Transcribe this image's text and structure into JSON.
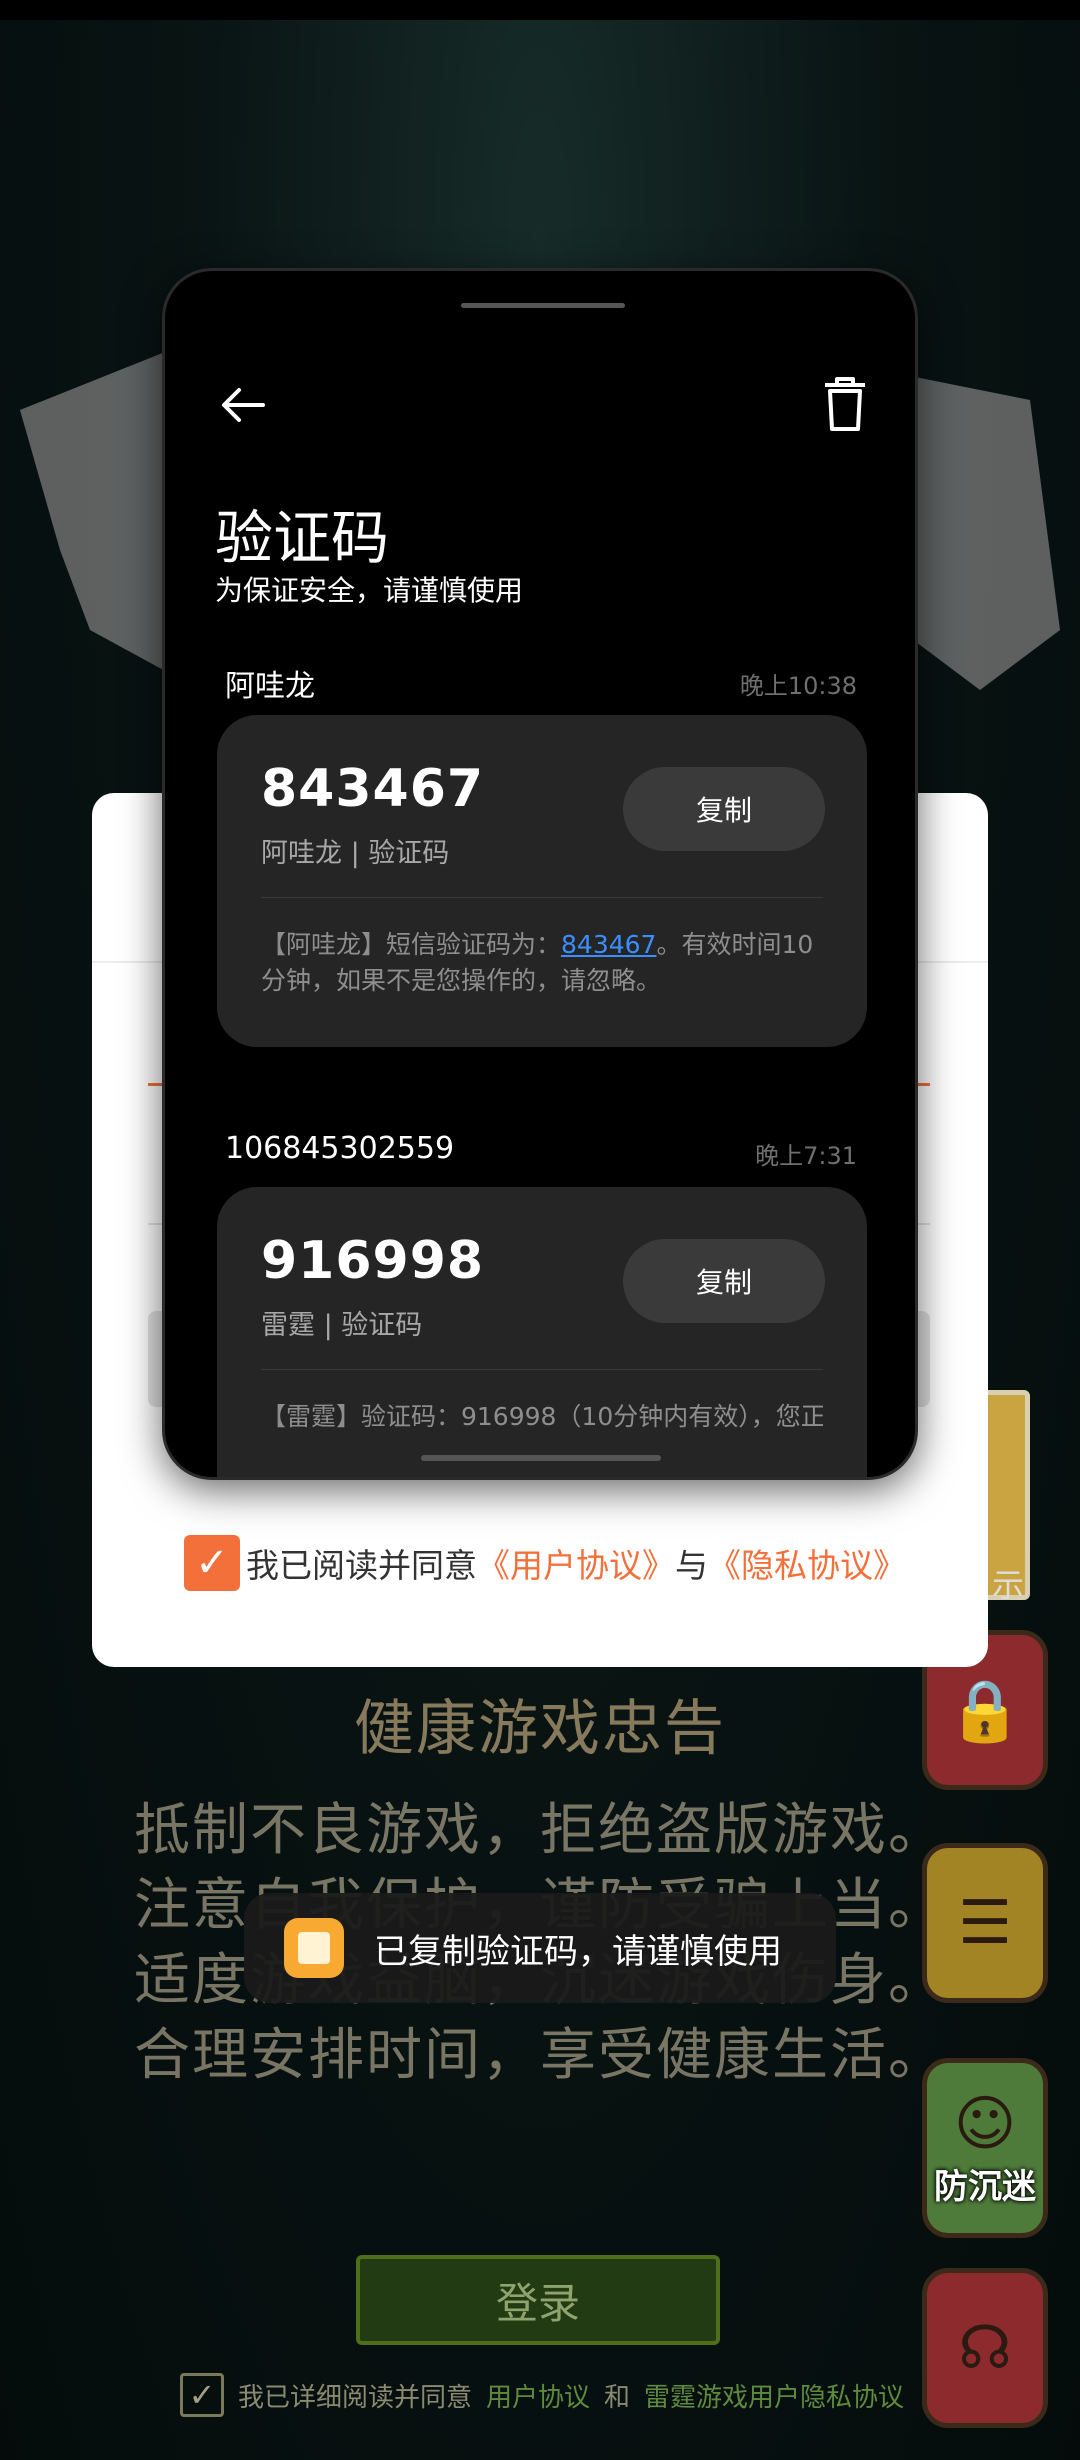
{
  "sms_popup": {
    "title": "验证码",
    "subtitle": "为保证安全，请谨慎使用",
    "messages": [
      {
        "sender": "阿哇龙",
        "time": "晚上10:38",
        "code": "843467",
        "code_sub": "阿哇龙 | 验证码",
        "copy_label": "复制",
        "body_prefix": "【阿哇龙】短信验证码为：",
        "body_code": "843467",
        "body_suffix": "。有效时间10分钟，如果不是您操作的，请忽略。"
      },
      {
        "sender": "106845302559",
        "time": "晚上7:31",
        "code": "916998",
        "code_sub": "雷霆 | 验证码",
        "copy_label": "复制",
        "body_text": "【雷霆】验证码：916998（10分钟内有效），您正"
      }
    ]
  },
  "login_dialog": {
    "agree_prefix": "我已阅读并同意",
    "user_agreement": "《用户协议》",
    "and": "与",
    "privacy_agreement": "《隐私协议》"
  },
  "toast": {
    "text": "已复制验证码，请谨慎使用"
  },
  "game": {
    "notice_title": "健康游戏忠告",
    "notice_lines": [
      "抵制不良游戏，拒绝盗版游戏。",
      "注意自我保护，谨防受骗上当。",
      "适度游戏益脑，沉迷游戏伤身。",
      "合理安排时间，享受健康生活。"
    ],
    "login_button": "登录",
    "agree_prefix": "我已详细阅读并同意",
    "user_agreement": "用户协议",
    "and": "和",
    "privacy": "雷霆游戏用户隐私协议",
    "side_anti_addiction": "防沉迷",
    "side_partial": "示"
  },
  "colors": {
    "accent_orange": "#f4703a",
    "link_blue": "#3a8eff",
    "popup_bg": "#000000",
    "card_bg": "#252525"
  }
}
